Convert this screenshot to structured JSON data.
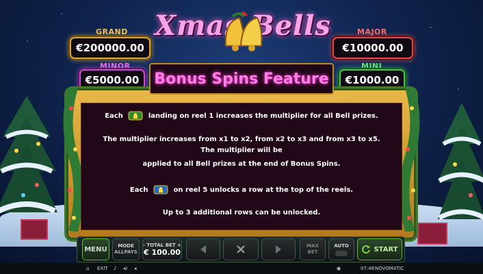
{
  "game": {
    "logo_text": "Xmas Bells"
  },
  "jackpots": {
    "grand": {
      "label": "GRAND",
      "value": "€200000.00",
      "color": "#d9a93a"
    },
    "minor": {
      "label": "MINOR",
      "value": "€5000.00",
      "color": "#c94bd4"
    },
    "major": {
      "label": "MAJOR",
      "value": "€10000.00",
      "color": "#e04b4b"
    },
    "mini": {
      "label": "MINI",
      "value": "€1000.00",
      "color": "#46c44b"
    }
  },
  "panel": {
    "title": "Bonus Spins Feature",
    "line1_pre": "Each",
    "line1_post": "landing on reel 1 increases the multiplier for all Bell prizes.",
    "line2": "The multiplier increases from x1 to x2, from x2 to x3 and from x3 to x5.",
    "line3": "The multiplier will be",
    "line4": "applied to all Bell prizes at the end of Bonus Spins.",
    "line5_pre": "Each",
    "line5_post": "on reel 5 unlocks a row at the top of the reels.",
    "line6": "Up to 3 additional rows can be unlocked."
  },
  "controls": {
    "menu": "MENU",
    "mode_label": "MODE",
    "mode_value": "ALLPAYS",
    "total_bet_label": "- TOTAL BET +",
    "total_bet_value": "€ 100.00",
    "max_bet_line1": "MAX",
    "max_bet_line2": "BET",
    "auto": "AUTO",
    "start": "START"
  },
  "status": {
    "exit": "EXIT",
    "time": "07:48",
    "brand": "NOVOMATIC"
  }
}
